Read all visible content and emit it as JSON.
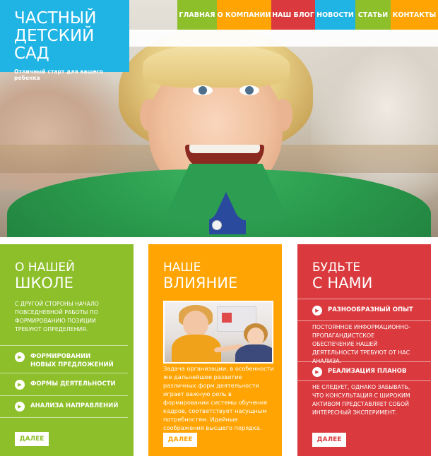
{
  "brand": {
    "title_line1": "ЧАСТНЫЙ",
    "title_line2": "ДЕТСКИЙ САД",
    "tagline": "Отличный старт для вашего ребенка",
    "color": "#1fb4e4"
  },
  "nav": [
    {
      "label": "ГЛАВНАЯ",
      "color": "#8dbf2a"
    },
    {
      "label": "О КОМПАНИИ",
      "color": "#ffa402"
    },
    {
      "label": "НАШ БЛОГ",
      "color": "#da3a3e"
    },
    {
      "label": "НОВОСТИ",
      "color": "#1fb4e4"
    },
    {
      "label": "СТАТЬИ",
      "color": "#8dbf2a"
    },
    {
      "label": "КОНТАКТЫ",
      "color": "#ffa402"
    }
  ],
  "columns": {
    "about": {
      "title1": "О нашей",
      "title2": "школе",
      "text": "С другой стороны начало повседневной работы по формированию позиции требуют определения.",
      "items": [
        "Формировании новых предложений",
        "Формы деятельности",
        "Анализа направлений"
      ],
      "more_label": "ДАЛЕЕ",
      "color": "#8dbf2a"
    },
    "influence": {
      "title1": "Наше",
      "title2": "влияние",
      "text": "Задача организации, в особенности же дальнейшее развитие различных форм деятельности играет важную роль в формировании системы обучения кадров, соответствует насущным потребностям. Идейные соображения высшего порядка.",
      "more_label": "ДАЛЕЕ",
      "color": "#ffa402"
    },
    "contact": {
      "title1": "Будьте",
      "title2": "с нами",
      "items": [
        {
          "label": "Разнообразный опыт",
          "text": "Постоянное информационно-пропагандистское обеспечение нашей деятельности требуют от нас анализа."
        },
        {
          "label": "Реализация планов",
          "text": "Не следует, однако забывать, что консультация с широким активом представляет собой интересный эксперимент."
        }
      ],
      "more_label": "ДАЛЕЕ",
      "color": "#da3a3e"
    }
  }
}
